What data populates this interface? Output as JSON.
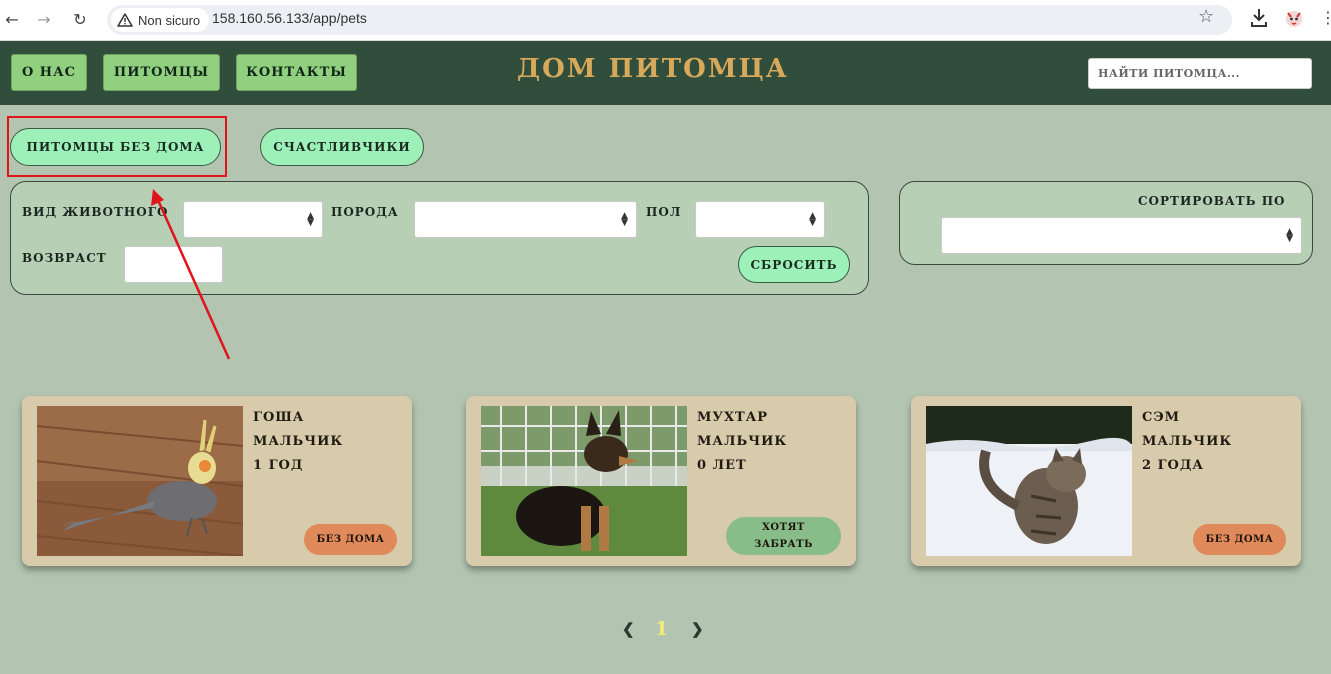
{
  "browser": {
    "security_label": "Non sicuro",
    "url": "158.160.56.133/app/pets"
  },
  "header": {
    "nav": [
      "О НАС",
      "ПИТОМЦЫ",
      "КОНТАКТЫ"
    ],
    "brand": "ДОМ ПИТОМЦА",
    "search_placeholder": "НАЙТИ ПИТОМЦА..."
  },
  "tabs": {
    "homeless": "ПИТОМЦЫ БЕЗ ДОМА",
    "lucky": "СЧАСТЛИВЧИКИ"
  },
  "filters": {
    "species_label": "ВИД ЖИВОТНОГО",
    "breed_label": "ПОРОДА",
    "sex_label": "ПОЛ",
    "age_label": "ВОЗВРАСТ",
    "reset_label": "СБРОСИТЬ",
    "sort_label": "СОРТИРОВАТЬ ПО"
  },
  "pets": [
    {
      "name": "ГОША",
      "sex": "МАЛЬЧИК",
      "age": "1 ГОД",
      "status": "БЕЗ ДОМА",
      "photo": "cockatiel-photo"
    },
    {
      "name": "МУХТАР",
      "sex": "МАЛЬЧИК",
      "age": "0 ЛЕТ",
      "status_line1": "ХОТЯТ",
      "status_line2": "ЗАБРАТЬ",
      "photo": "shepherd-puppy-photo"
    },
    {
      "name": "СЭМ",
      "sex": "МАЛЬЧИК",
      "age": "2 ГОДА",
      "status": "БЕЗ ДОМА",
      "photo": "cat-in-snow-photo"
    }
  ],
  "pagination": {
    "prev": "❮",
    "current": "1",
    "next": "❯"
  },
  "colors": {
    "page_bg": "#b3c5b1",
    "header_bg": "#314d3b",
    "brand": "#d8a95a",
    "nav_button": "#90d07f",
    "tab_button": "#9cf0b8",
    "card_bg": "#d8cbab",
    "status_homeless": "#e08a5c",
    "status_wanted": "#88bd8a",
    "annotation_red": "#e0141a",
    "page_current": "#f3ec7a"
  }
}
